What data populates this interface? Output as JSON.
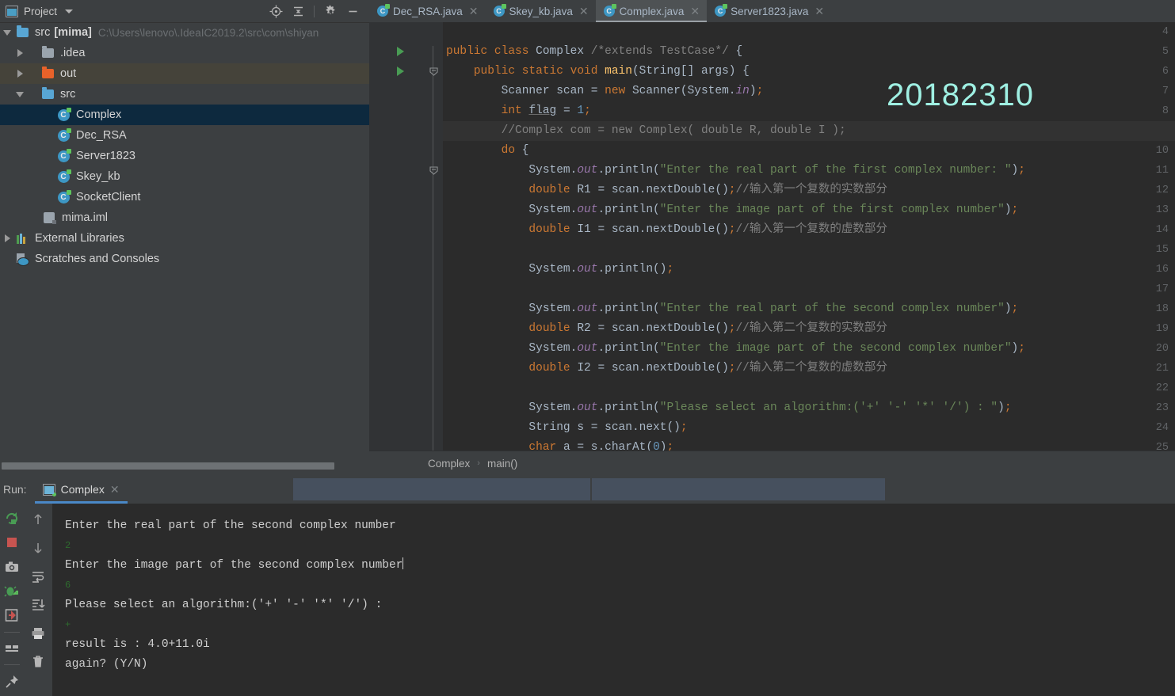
{
  "project_panel": {
    "title": "Project",
    "tools": [
      "locate-icon",
      "collapse-all-icon",
      "settings-icon",
      "minimize-icon"
    ],
    "root": {
      "name": "src",
      "module": "[mima]",
      "path": "C:\\Users\\lenovo\\.IdeaIC2019.2\\src\\com\\shiyan"
    },
    "items": [
      {
        "label": ".idea",
        "icon": "folder-icon",
        "indent": 1,
        "state": "collapsed",
        "selected": false
      },
      {
        "label": "out",
        "icon": "folder-out-icon",
        "indent": 1,
        "state": "collapsed",
        "selected": false,
        "highlighted": true
      },
      {
        "label": "src",
        "icon": "folder-src-icon",
        "indent": 1,
        "state": "expanded",
        "selected": false
      },
      {
        "label": "Complex",
        "icon": "java-class-icon",
        "indent": 3,
        "state": "leaf",
        "selected": true
      },
      {
        "label": "Dec_RSA",
        "icon": "java-class-icon",
        "indent": 3,
        "state": "leaf",
        "selected": false
      },
      {
        "label": "Server1823",
        "icon": "java-class-icon",
        "indent": 3,
        "state": "leaf",
        "selected": false
      },
      {
        "label": "Skey_kb",
        "icon": "java-class-icon",
        "indent": 3,
        "state": "leaf",
        "selected": false
      },
      {
        "label": "SocketClient",
        "icon": "java-class-icon",
        "indent": 3,
        "state": "leaf",
        "selected": false
      },
      {
        "label": "mima.iml",
        "icon": "iml-file-icon",
        "indent": 2,
        "state": "leaf",
        "selected": false
      },
      {
        "label": "External Libraries",
        "icon": "libraries-icon",
        "indent": 0,
        "state": "collapsed",
        "selected": false
      },
      {
        "label": "Scratches and Consoles",
        "icon": "scratches-icon",
        "indent": 0,
        "state": "leaf",
        "selected": false
      }
    ]
  },
  "editor": {
    "tabs": [
      {
        "label": "Dec_RSA.java",
        "active": false
      },
      {
        "label": "Skey_kb.java",
        "active": false
      },
      {
        "label": "Complex.java",
        "active": true
      },
      {
        "label": "Server1823.java",
        "active": false
      }
    ],
    "watermark": "20182310",
    "first_line_number": 4,
    "breadcrumb": {
      "class": "Complex",
      "separator": "›",
      "method": "main()"
    },
    "lines": [
      {
        "n": 4,
        "run": false,
        "fold": "",
        "text": "",
        "current": false
      },
      {
        "n": 5,
        "run": true,
        "fold": "",
        "text": "public class Complex /*extends TestCase*/ {",
        "current": false
      },
      {
        "n": 6,
        "run": true,
        "fold": "minus",
        "text": "    public static void main(String[] args) {",
        "current": false
      },
      {
        "n": 7,
        "run": false,
        "fold": "",
        "text": "        Scanner scan = new Scanner(System.in);",
        "current": false
      },
      {
        "n": 8,
        "run": false,
        "fold": "",
        "text": "        int flag = 1;",
        "current": false
      },
      {
        "n": 9,
        "run": false,
        "fold": "",
        "text": "        //Complex com = new Complex( double R, double I );",
        "current": true
      },
      {
        "n": 10,
        "run": false,
        "fold": "minus",
        "text": "        do {",
        "current": false
      },
      {
        "n": 11,
        "run": false,
        "fold": "",
        "text": "            System.out.println(\"Enter the real part of the first complex number: \");",
        "current": false
      },
      {
        "n": 12,
        "run": false,
        "fold": "",
        "text": "            double R1 = scan.nextDouble();//输入第一个复数的实数部分",
        "current": false
      },
      {
        "n": 13,
        "run": false,
        "fold": "",
        "text": "            System.out.println(\"Enter the image part of the first complex number\");",
        "current": false
      },
      {
        "n": 14,
        "run": false,
        "fold": "",
        "text": "            double I1 = scan.nextDouble();//输入第一个复数的虚数部分",
        "current": false
      },
      {
        "n": 15,
        "run": false,
        "fold": "",
        "text": "",
        "current": false
      },
      {
        "n": 16,
        "run": false,
        "fold": "",
        "text": "            System.out.println();",
        "current": false
      },
      {
        "n": 17,
        "run": false,
        "fold": "",
        "text": "",
        "current": false
      },
      {
        "n": 18,
        "run": false,
        "fold": "",
        "text": "            System.out.println(\"Enter the real part of the second complex number\");",
        "current": false
      },
      {
        "n": 19,
        "run": false,
        "fold": "",
        "text": "            double R2 = scan.nextDouble();//输入第二个复数的实数部分",
        "current": false
      },
      {
        "n": 20,
        "run": false,
        "fold": "",
        "text": "            System.out.println(\"Enter the image part of the second complex number\");",
        "current": false
      },
      {
        "n": 21,
        "run": false,
        "fold": "",
        "text": "            double I2 = scan.nextDouble();//输入第二个复数的虚数部分",
        "current": false
      },
      {
        "n": 22,
        "run": false,
        "fold": "",
        "text": "",
        "current": false
      },
      {
        "n": 23,
        "run": false,
        "fold": "",
        "text": "            System.out.println(\"Please select an algorithm:('+' '-' '*' '/') : \");",
        "current": false
      },
      {
        "n": 24,
        "run": false,
        "fold": "",
        "text": "            String s = scan.next();",
        "current": false
      },
      {
        "n": 25,
        "run": false,
        "fold": "",
        "text": "            char a = s.charAt(0);",
        "current": false
      }
    ]
  },
  "run_panel": {
    "label": "Run:",
    "tab": "Complex",
    "left_tools": [
      "rerun-icon",
      "stop-icon",
      "camera-icon",
      "debug-icon",
      "exit-icon",
      "layout-icon",
      "pin-icon"
    ],
    "right_tools": [
      "up-arrow-icon",
      "down-arrow-icon",
      "soft-wrap-icon",
      "scroll-to-end-icon",
      "print-icon",
      "trash-icon"
    ],
    "console_lines": [
      {
        "text": "Enter the real part of the second complex number",
        "kind": "output"
      },
      {
        "text": "2",
        "kind": "input"
      },
      {
        "text": "Enter the image part of the second complex number",
        "kind": "output",
        "caret": true
      },
      {
        "text": "6",
        "kind": "input"
      },
      {
        "text": "Please select an algorithm:('+' '-' '*' '/') : ",
        "kind": "output"
      },
      {
        "text": "+",
        "kind": "input"
      },
      {
        "text": "result is : 4.0+11.0i",
        "kind": "output"
      },
      {
        "text": "again? (Y/N)",
        "kind": "output"
      }
    ]
  },
  "colors": {
    "panel_bg": "#3c3f41",
    "editor_bg": "#2b2b2b",
    "selection": "#0d293e",
    "accent": "#4a88c7",
    "watermark": "#9ff0e3",
    "keyword": "#cc7832",
    "string": "#6a8759",
    "comment": "#808080",
    "method": "#ffc66d",
    "identifier": "#a9b7c6"
  }
}
